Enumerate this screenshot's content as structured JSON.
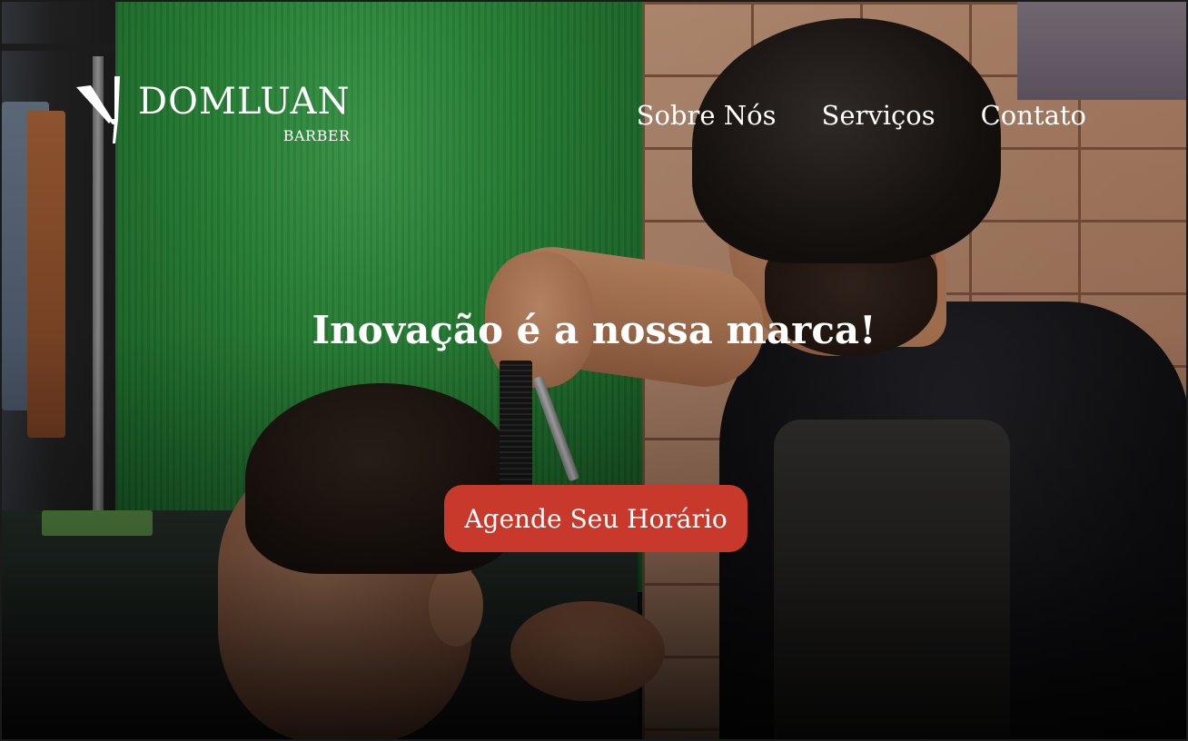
{
  "brand": {
    "name": "DOMLUAN",
    "subtitle": "BARBER",
    "icon": "razor-icon"
  },
  "nav": {
    "items": [
      {
        "label": "Sobre Nós"
      },
      {
        "label": "Serviços"
      },
      {
        "label": "Contato"
      }
    ]
  },
  "hero": {
    "headline": "Inovação é a nossa marca!",
    "cta_label": "Agende Seu Horário",
    "background": "barber-cutting-client-photo"
  },
  "colors": {
    "accent": "#c8392b",
    "text": "#ffffff"
  }
}
